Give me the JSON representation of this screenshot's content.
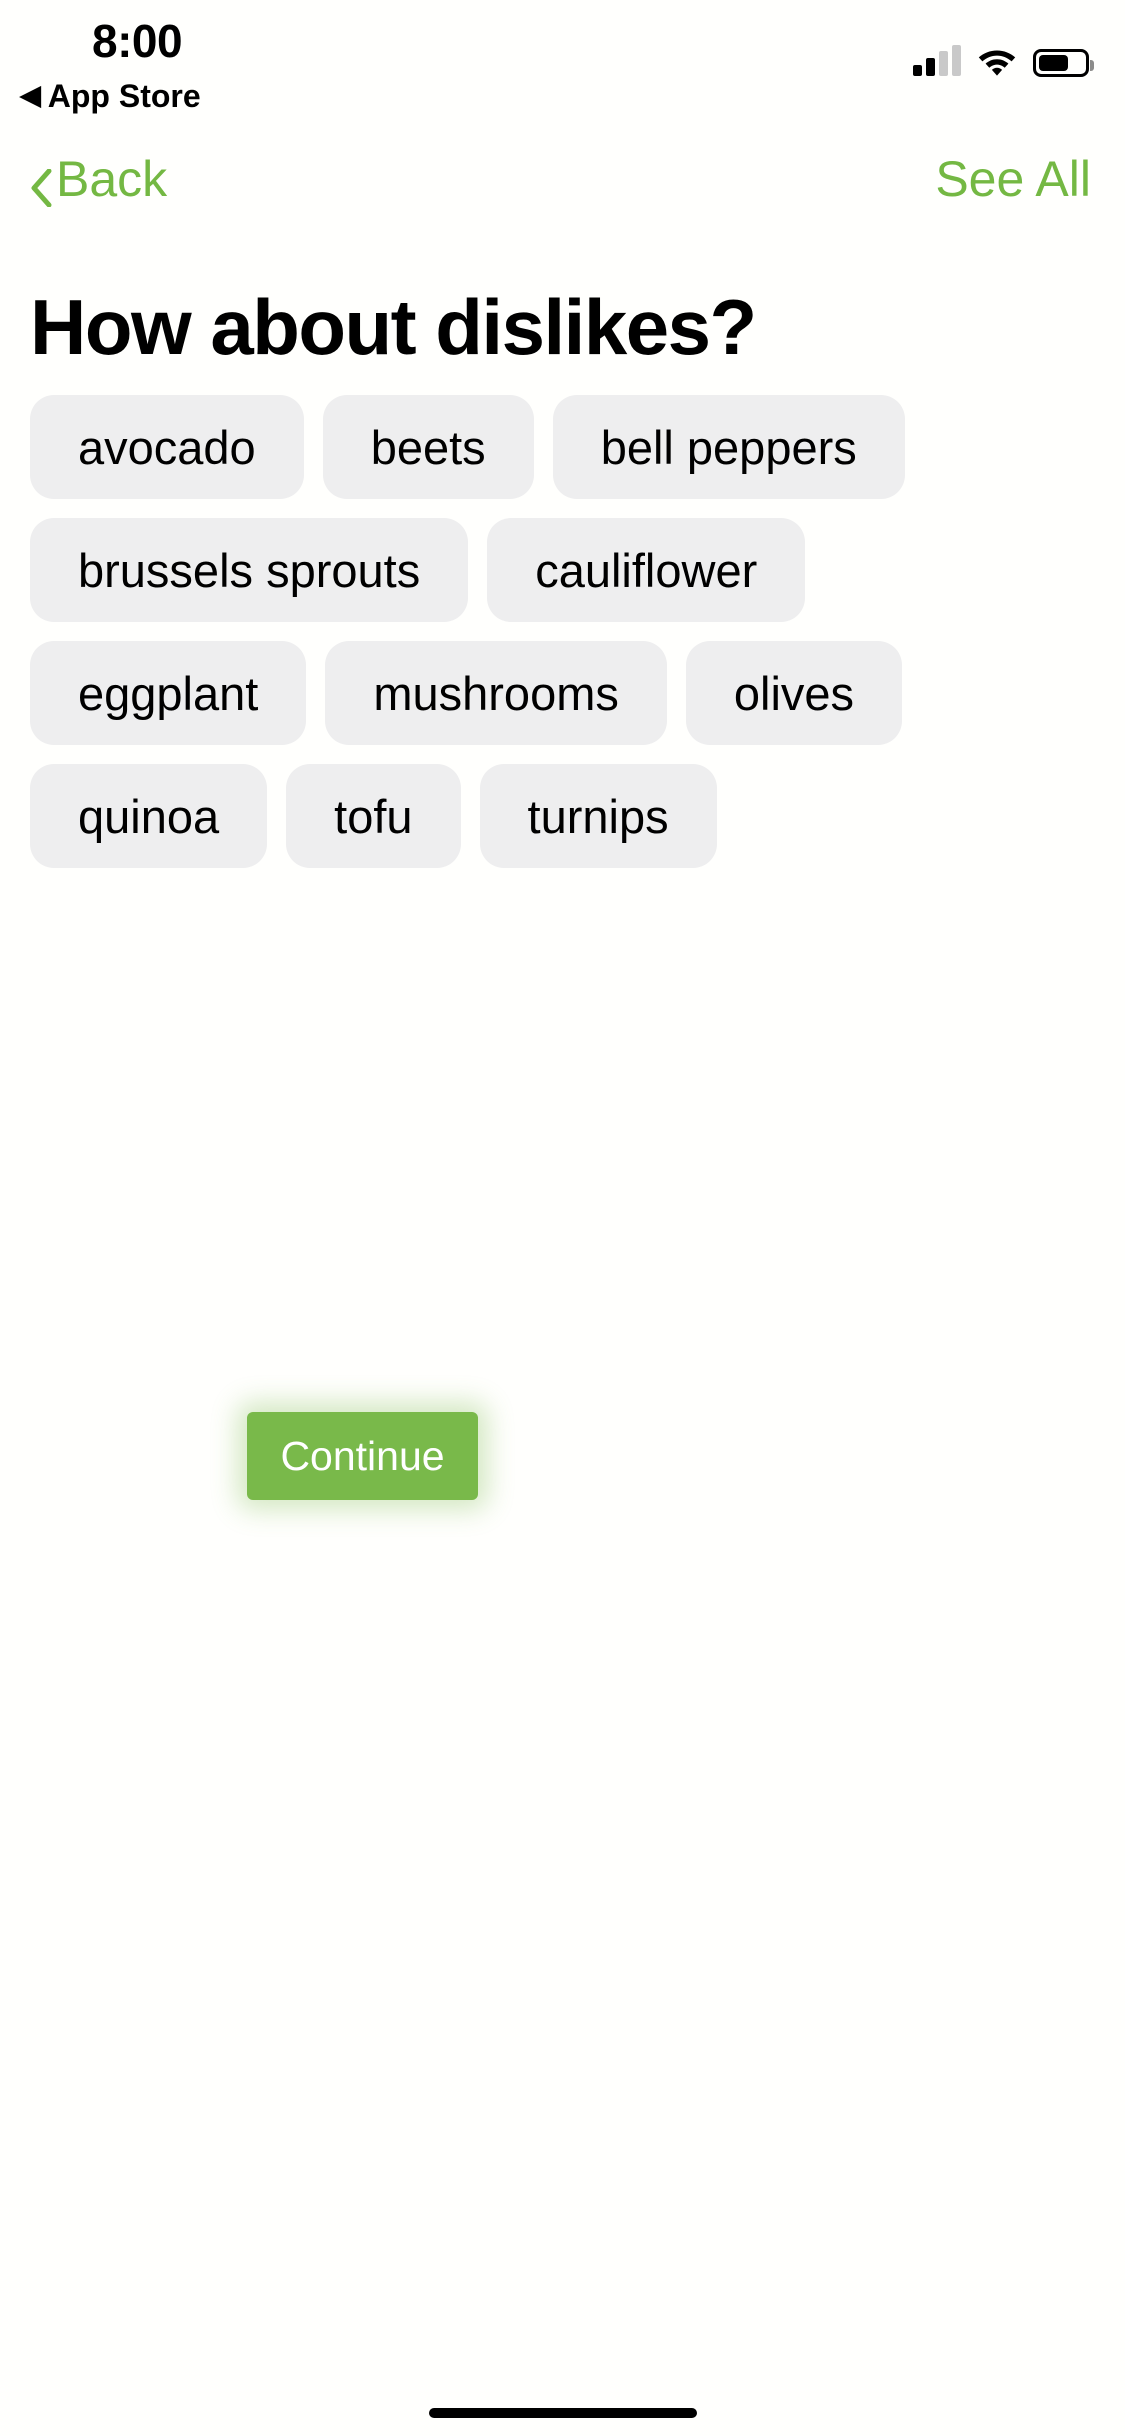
{
  "status_bar": {
    "time": "8:00",
    "return_app_label": "App Store",
    "return_arrow_glyph": "◀",
    "icons": {
      "cellular": "cellular-signal-icon",
      "wifi": "wifi-icon",
      "battery": "battery-icon"
    },
    "battery_level_percent": 58,
    "cellular_bars_active": 2,
    "cellular_bars_total": 4
  },
  "nav_bar": {
    "back_label": "Back",
    "back_chevron_glyph": "‹",
    "see_all_label": "See All",
    "accent_color": "#74b843"
  },
  "page": {
    "title": "How about dislikes?"
  },
  "chips": {
    "background_color": "#eeeeef",
    "text_color": "#000000",
    "items": [
      {
        "label": "avocado"
      },
      {
        "label": "beets"
      },
      {
        "label": "bell peppers"
      },
      {
        "label": "brussels sprouts"
      },
      {
        "label": "cauliflower"
      },
      {
        "label": "eggplant"
      },
      {
        "label": "mushrooms"
      },
      {
        "label": "olives"
      },
      {
        "label": "quinoa"
      },
      {
        "label": "tofu"
      },
      {
        "label": "turnips"
      }
    ]
  },
  "footer": {
    "continue_label": "Continue",
    "continue_color": "#79b94a",
    "continue_text_color": "#ffffff"
  }
}
